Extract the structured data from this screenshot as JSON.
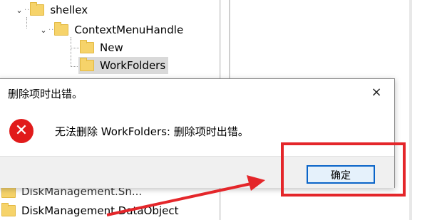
{
  "tree": {
    "items": [
      {
        "label": "shellex"
      },
      {
        "label": "ContextMenuHandle"
      },
      {
        "label": "New"
      },
      {
        "label": "WorkFolders"
      }
    ],
    "bottom_items": [
      {
        "label": "DiskManagement.DataObject"
      }
    ],
    "partial_item": "DiskManagement.Sn..."
  },
  "dialog": {
    "title": "删除项时出错。",
    "close_icon": "×",
    "error_icon": "✕",
    "message": "无法删除 WorkFolders: 删除项时出错。",
    "ok_label": "确定"
  },
  "annotation": {
    "color": "#e4262a"
  }
}
